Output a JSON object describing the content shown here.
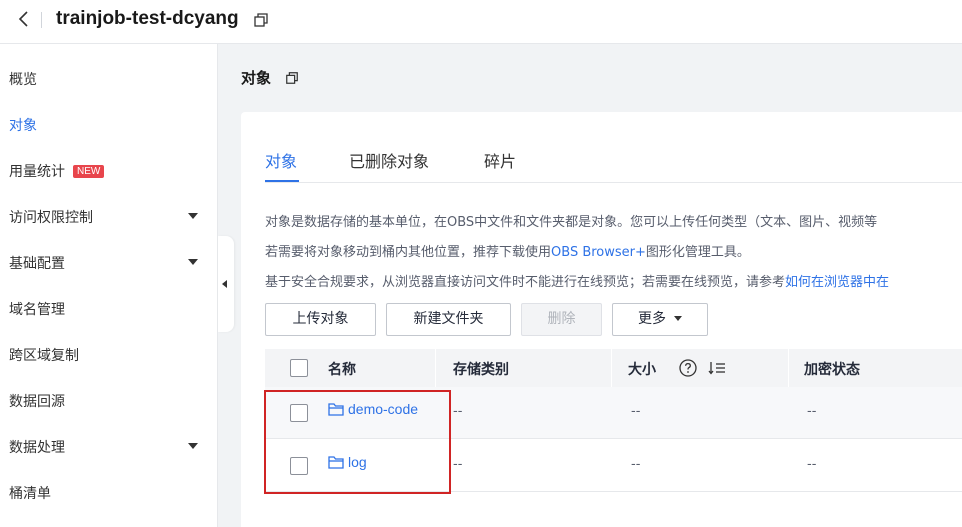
{
  "topbar": {
    "bucket_name": "trainjob-test-dcyang"
  },
  "sidebar": {
    "items": [
      {
        "label": "概览",
        "active": false,
        "expandable": false
      },
      {
        "label": "对象",
        "active": true,
        "expandable": false
      },
      {
        "label": "用量统计",
        "badge": "NEW",
        "active": false,
        "expandable": false
      },
      {
        "label": "访问权限控制",
        "active": false,
        "expandable": true
      },
      {
        "label": "基础配置",
        "active": false,
        "expandable": true
      },
      {
        "label": "域名管理",
        "active": false,
        "expandable": false
      },
      {
        "label": "跨区域复制",
        "active": false,
        "expandable": false
      },
      {
        "label": "数据回源",
        "active": false,
        "expandable": false
      },
      {
        "label": "数据处理",
        "active": false,
        "expandable": true
      },
      {
        "label": "桶清单",
        "active": false,
        "expandable": false
      }
    ]
  },
  "page": {
    "title": "对象"
  },
  "tabs": [
    "对象",
    "已删除对象",
    "碎片"
  ],
  "info": {
    "line1": "对象是数据存储的基本单位，在OBS中文件和文件夹都是对象。您可以上传任何类型（文本、图片、视频等",
    "line2_prefix": "若需要将对象移动到桶内其他位置，推荐下载使用",
    "line2_link": "OBS Browser+",
    "line2_suffix": "图形化管理工具。",
    "line3_prefix": "基于安全合规要求，从浏览器直接访问文件时不能进行在线预览；若需要在线预览，请参考",
    "line3_link": "如何在浏览器中在"
  },
  "toolbar": {
    "upload": "上传对象",
    "new_folder": "新建文件夹",
    "delete": "删除",
    "more": "更多"
  },
  "table": {
    "headers": {
      "name": "名称",
      "storage_class": "存储类别",
      "size": "大小",
      "encryption": "加密状态"
    },
    "rows": [
      {
        "name": "demo-code",
        "storage_class": "--",
        "size": "--",
        "encryption": "--"
      },
      {
        "name": "log",
        "storage_class": "--",
        "size": "--",
        "encryption": "--"
      }
    ]
  },
  "colors": {
    "accent": "#2e72e6",
    "highlight": "#d02424",
    "badge": "#e8454c"
  }
}
